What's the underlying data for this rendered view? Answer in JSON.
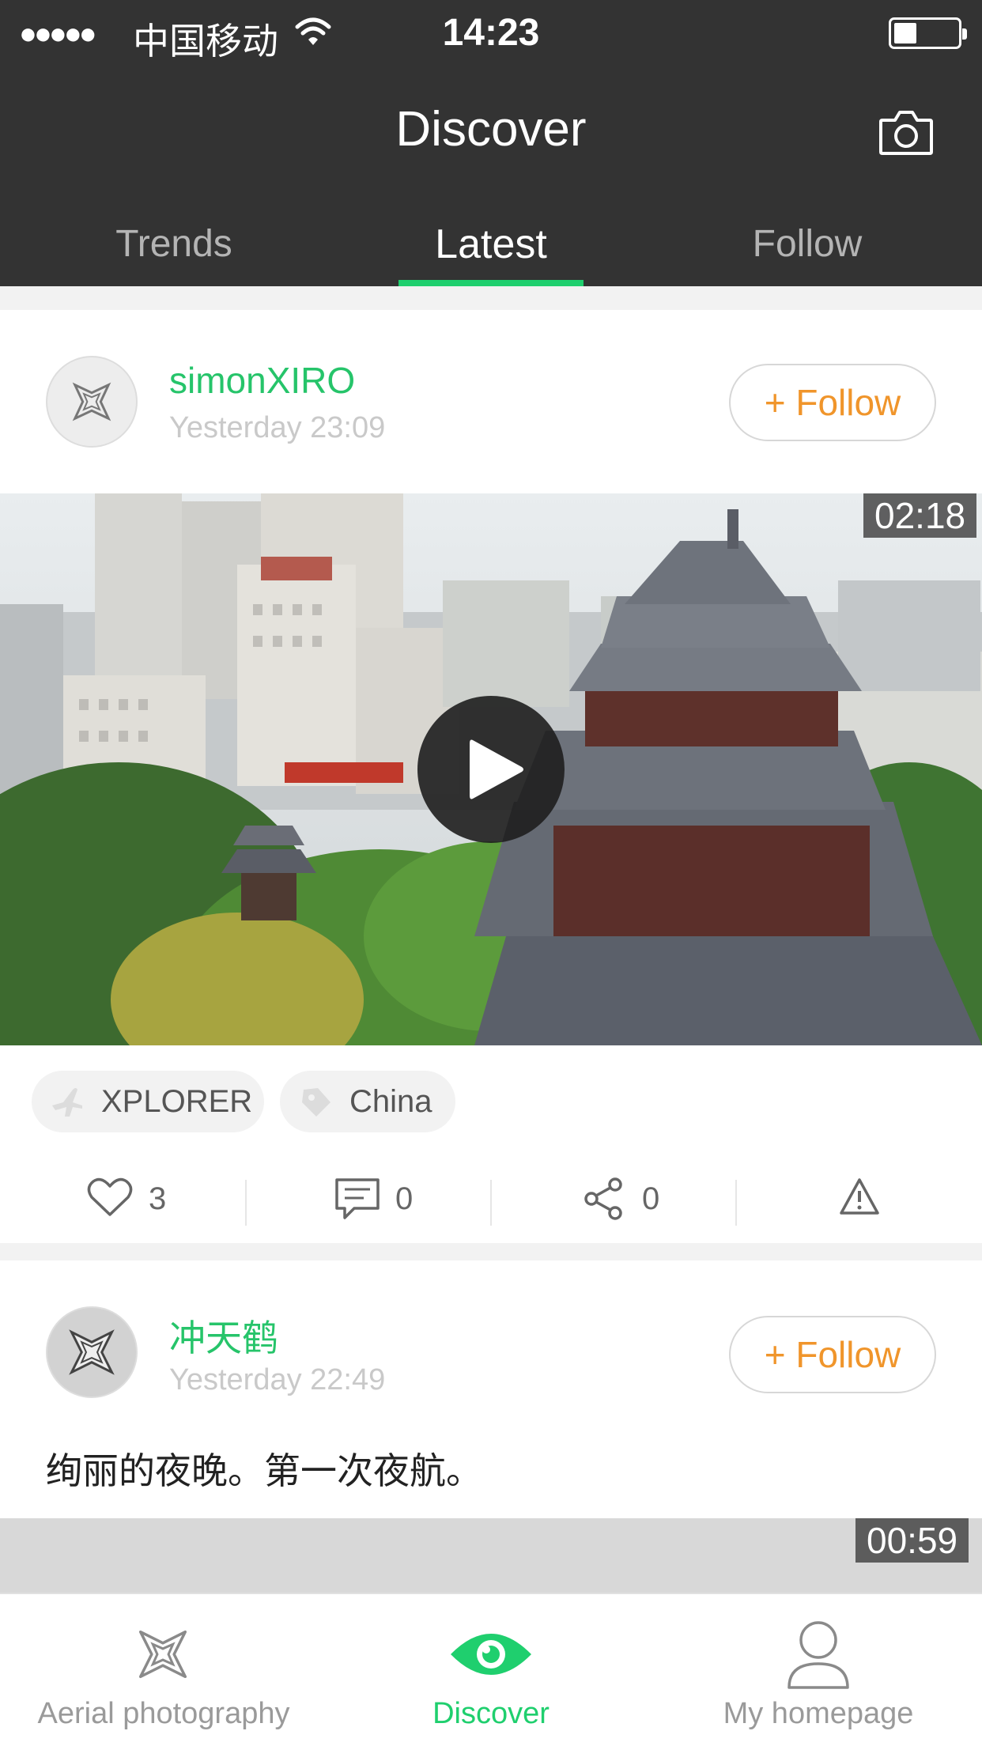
{
  "status_bar": {
    "signal": "●●●●●",
    "carrier": "中国移动",
    "time": "14:23"
  },
  "header": {
    "title": "Discover",
    "camera_icon": "camera-icon"
  },
  "tabs": [
    {
      "label": "Trends",
      "active": false
    },
    {
      "label": "Latest",
      "active": true
    },
    {
      "label": "Follow",
      "active": false
    }
  ],
  "accent_color": "#1fcf6e",
  "follow_color": "#f0952b",
  "posts": [
    {
      "username": "simonXIRO",
      "time": "Yesterday 23:09",
      "follow_label": "+ Follow",
      "duration": "02:18",
      "tags": [
        {
          "icon": "plane-icon",
          "label": "XPLORER"
        },
        {
          "icon": "location-tag-icon",
          "label": "China"
        }
      ],
      "likes": "3",
      "comments": "0",
      "shares": "0"
    },
    {
      "username": "冲天鹤",
      "time": "Yesterday 22:49",
      "follow_label": "+ Follow",
      "text": "绚丽的夜晚。第一次夜航。",
      "duration": "00:59"
    }
  ],
  "bottom_nav": [
    {
      "label": "Aerial photography",
      "icon": "drone-icon",
      "active": false
    },
    {
      "label": "Discover",
      "icon": "eye-icon",
      "active": true
    },
    {
      "label": "My homepage",
      "icon": "person-icon",
      "active": false
    }
  ]
}
